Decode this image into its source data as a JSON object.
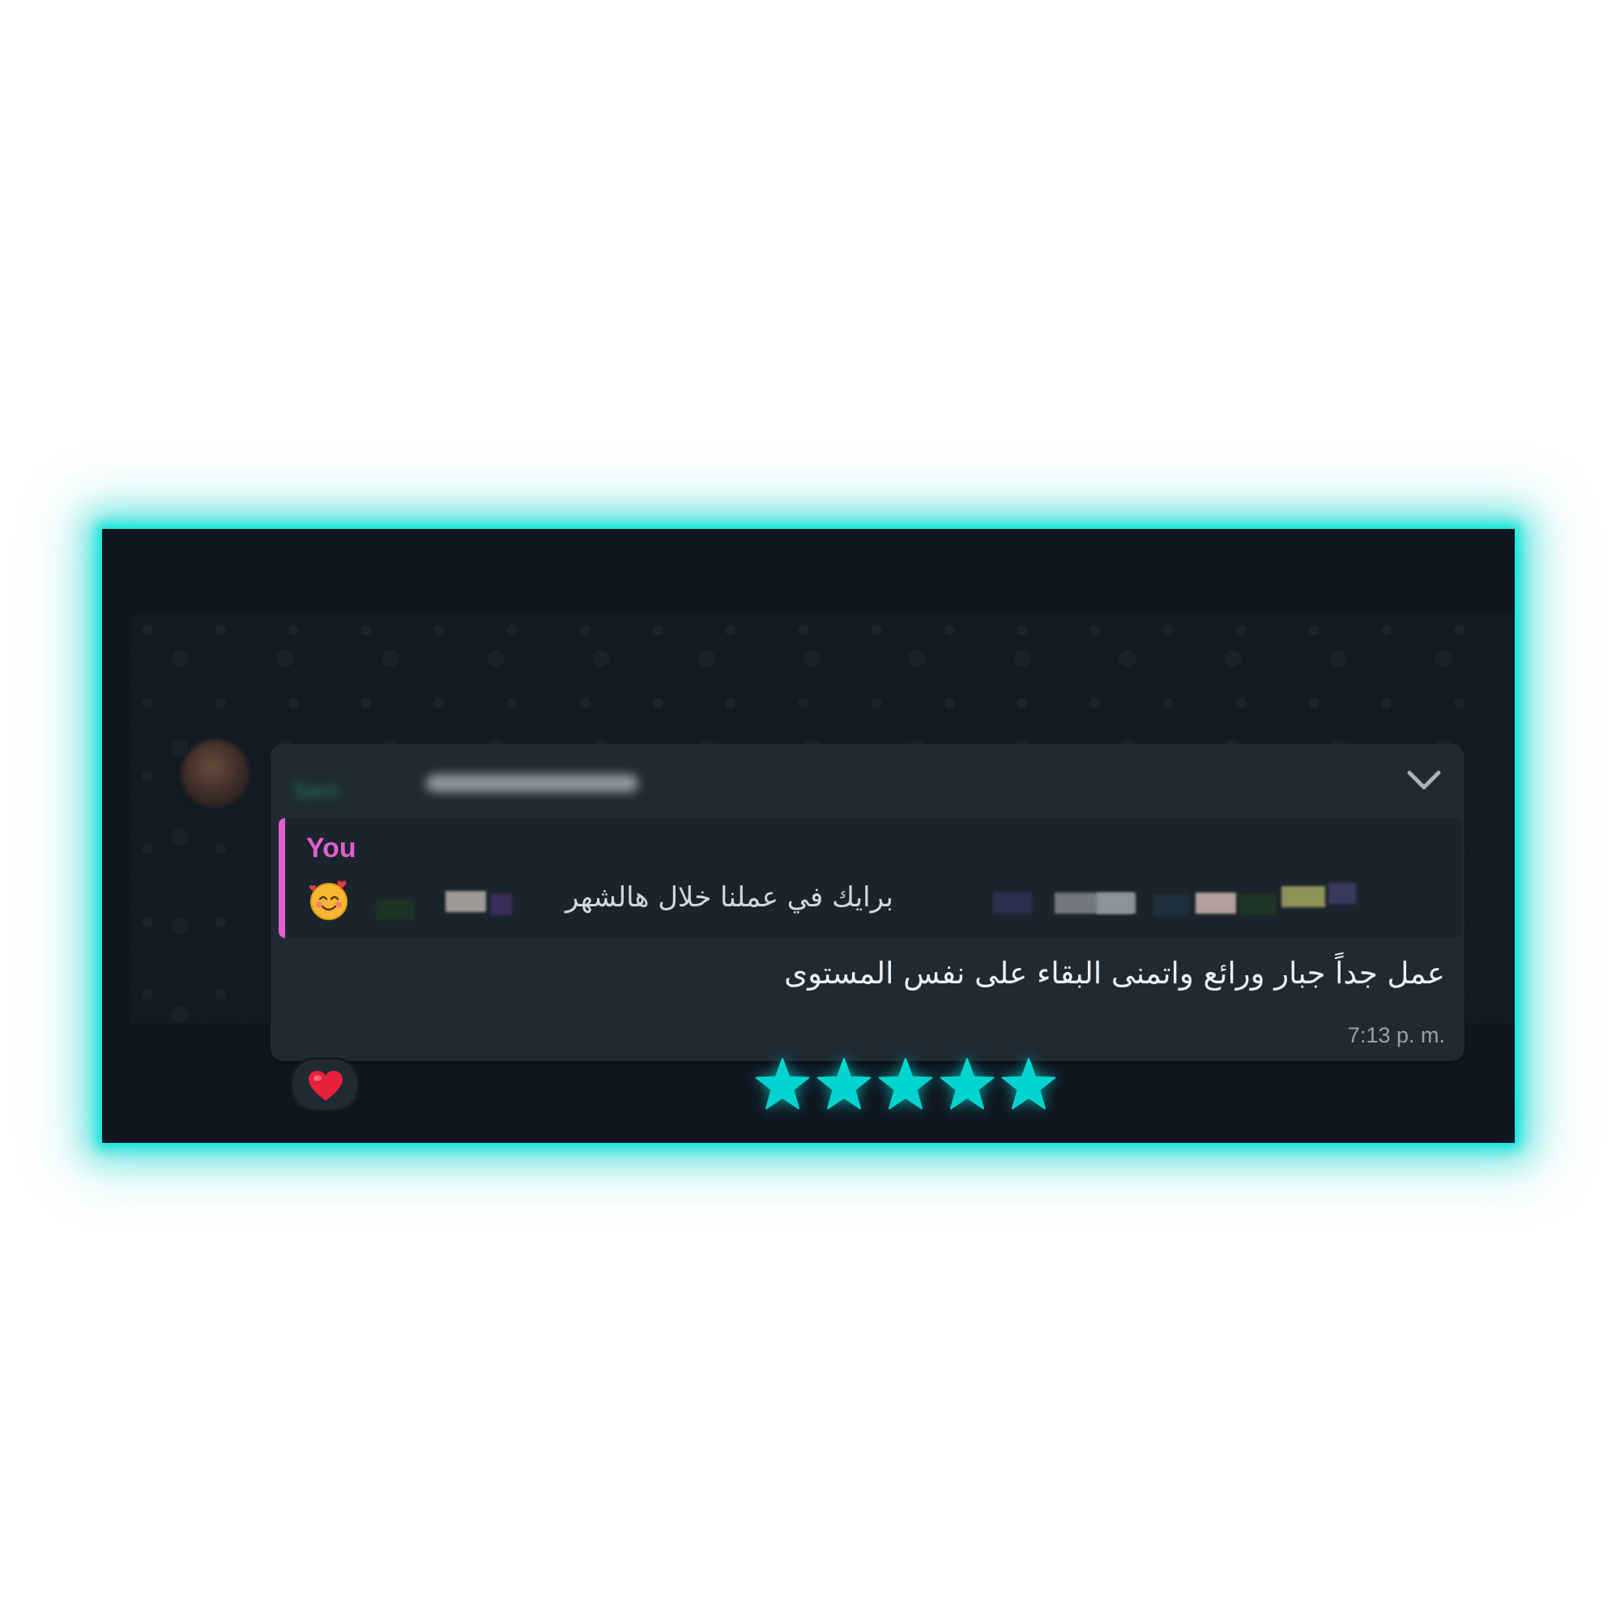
{
  "message": {
    "sender_name": "Sam",
    "quote": {
      "author": "You",
      "text": "برايك في عملنا خلال هالشهر",
      "emoji": "smiling-face-with-hearts-emoji"
    },
    "text": "عمل جداً جبار ورائع واتمنى البقاء على نفس المستوى",
    "time": "7:13 p. m.",
    "reaction": "red-heart-emoji"
  },
  "rating": {
    "stars": 5,
    "max": 5,
    "color": "#00d4d0"
  },
  "colors": {
    "glow": "#00e6dc",
    "background": "#0f1620",
    "bubble": "#1f2a33",
    "quote_accent": "#e05fcf"
  }
}
